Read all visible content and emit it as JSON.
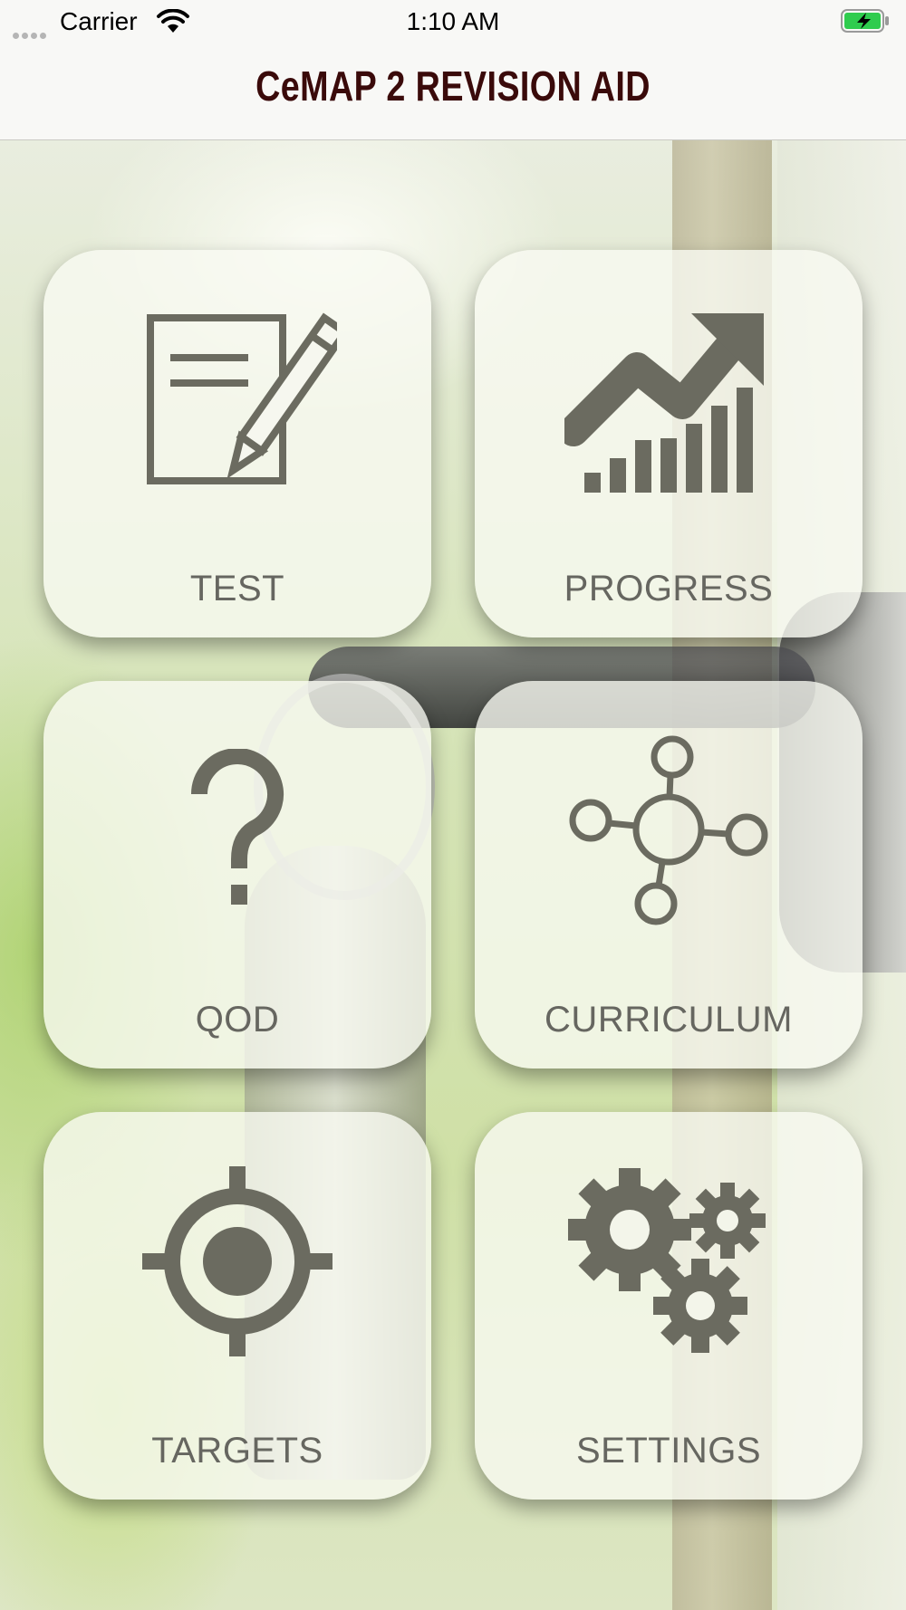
{
  "status_bar": {
    "carrier": "Carrier",
    "time": "1:10 AM",
    "battery_color": "#2fcc4e"
  },
  "nav": {
    "title": "CeMAP 2 REVISION AID",
    "title_color": "#3a0a0a"
  },
  "tiles": [
    {
      "label": "TEST",
      "icon": "test-document-pencil-icon"
    },
    {
      "label": "PROGRESS",
      "icon": "progress-chart-icon"
    },
    {
      "label": "QOD",
      "icon": "question-mark-icon"
    },
    {
      "label": "CURRICULUM",
      "icon": "curriculum-network-icon"
    },
    {
      "label": "TARGETS",
      "icon": "target-icon"
    },
    {
      "label": "SETTINGS",
      "icon": "settings-gears-icon"
    }
  ],
  "icon_color": "#6b6b60"
}
